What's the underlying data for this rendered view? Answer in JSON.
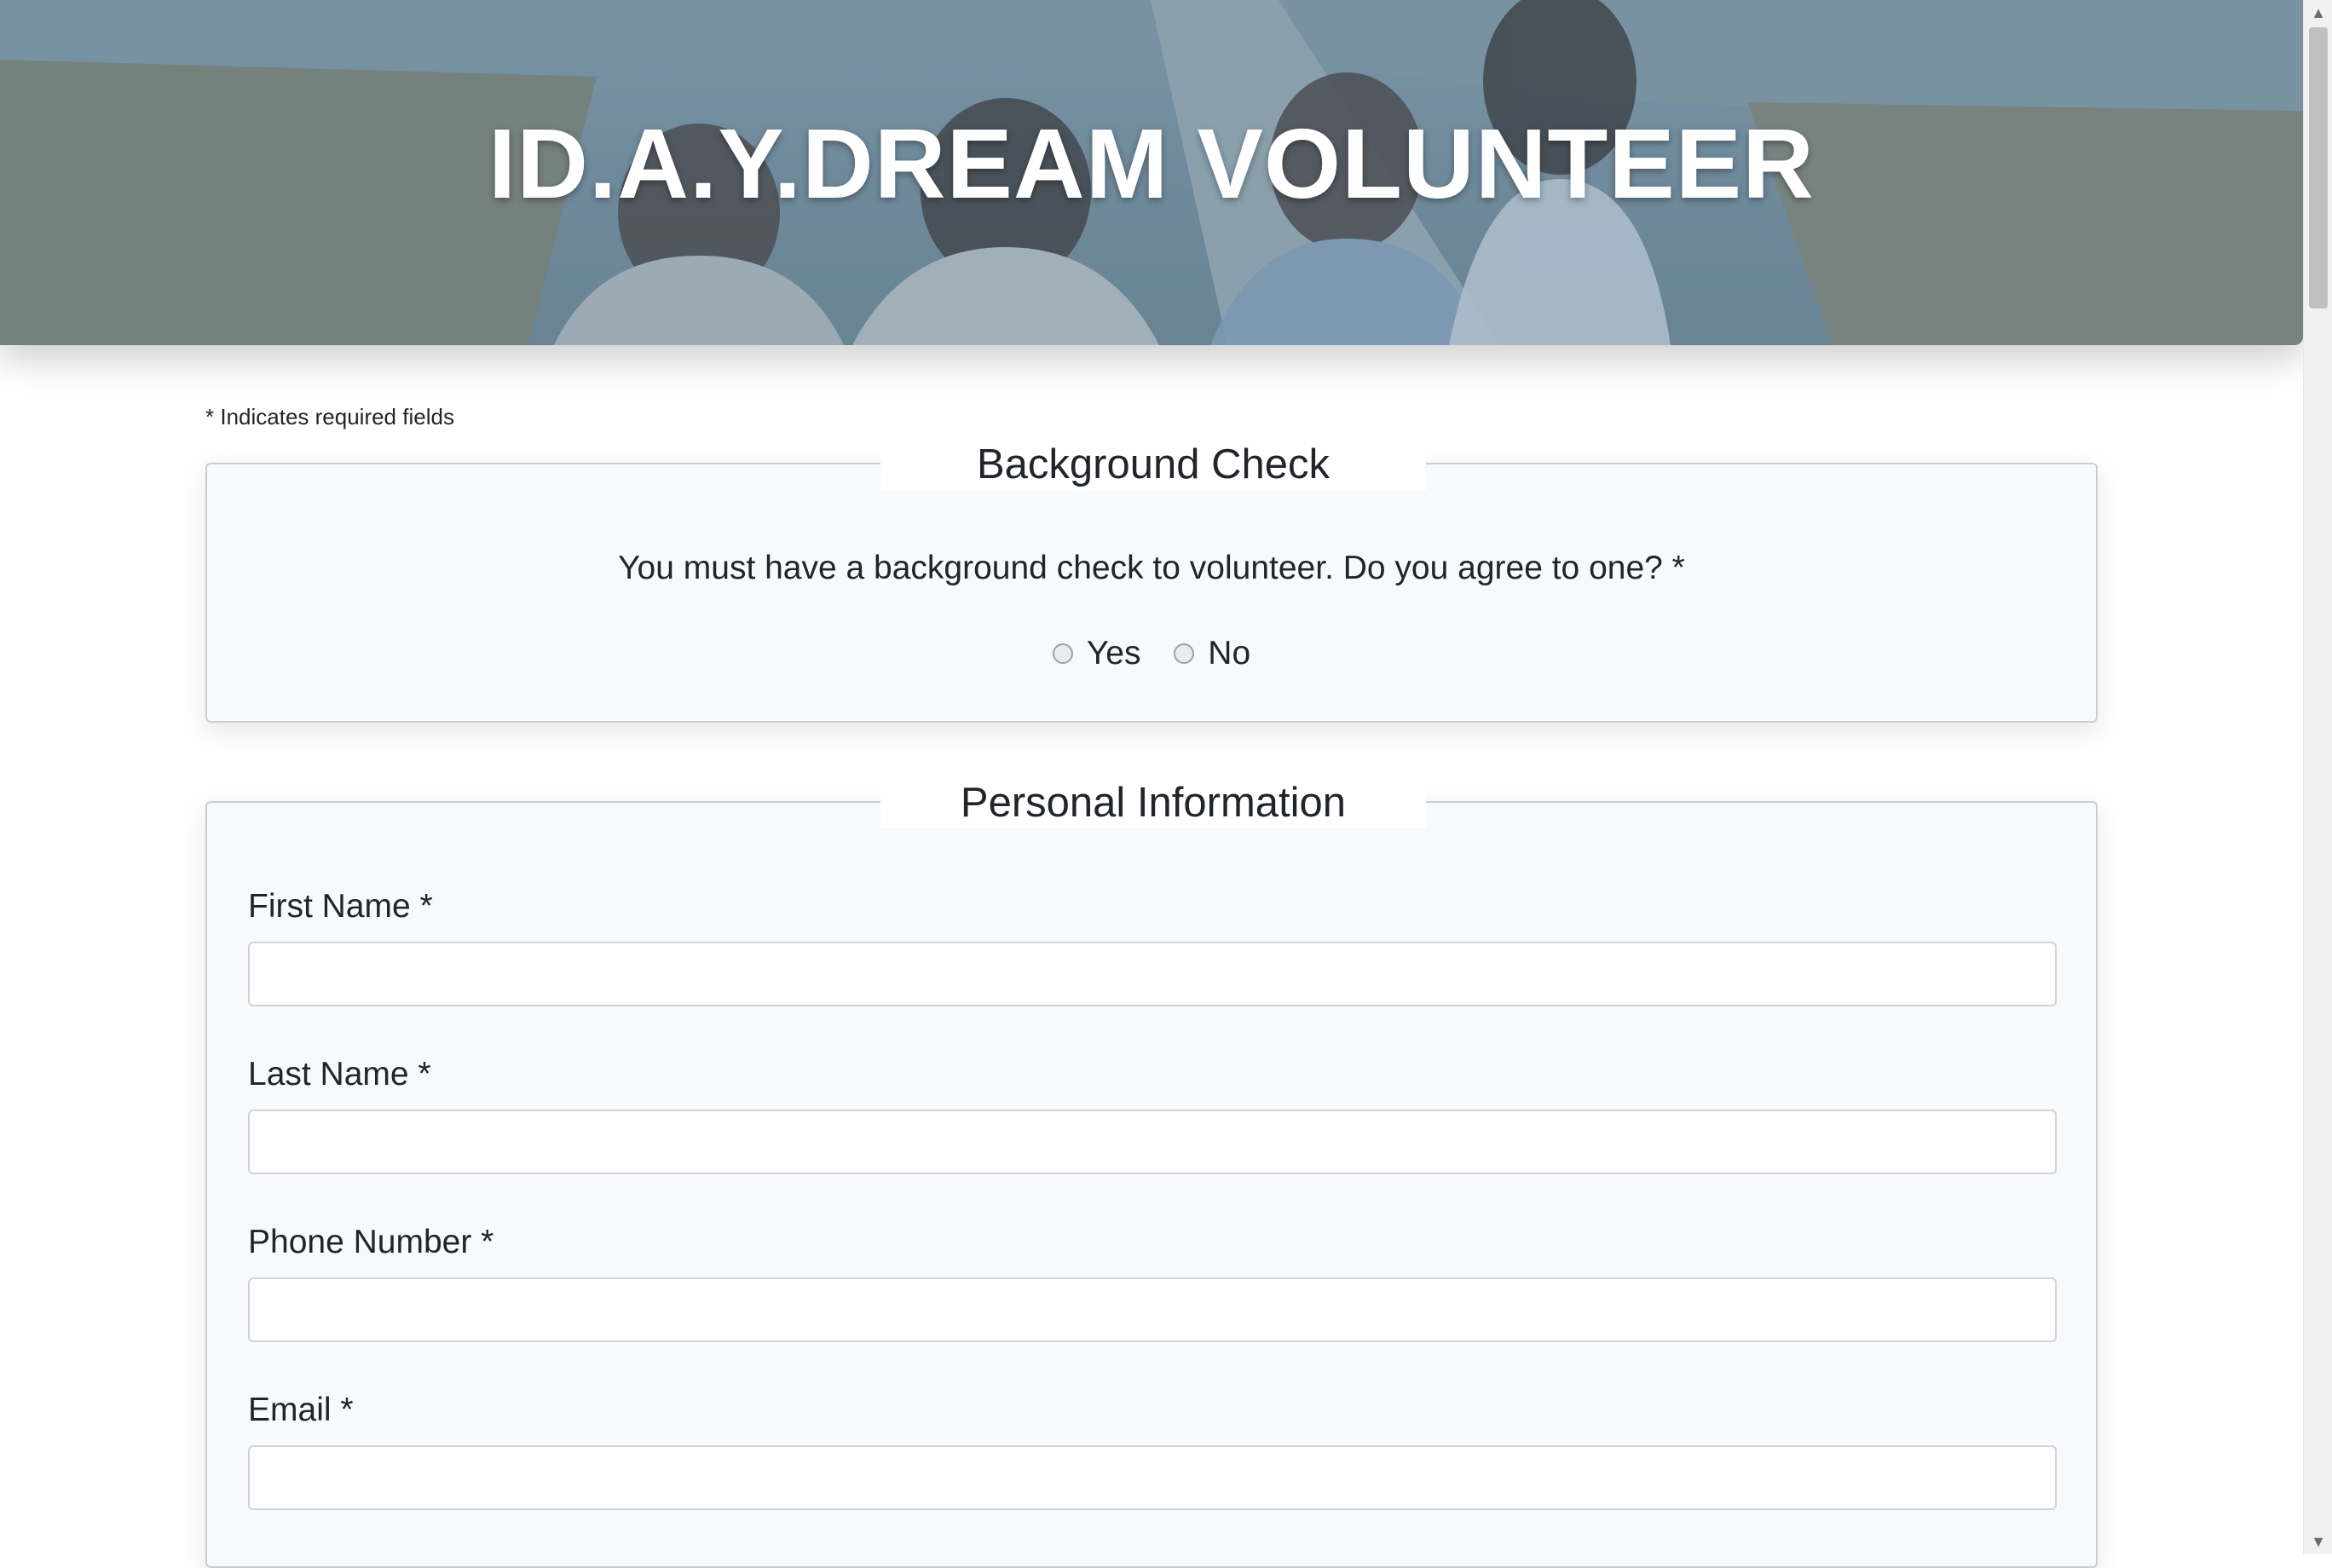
{
  "hero": {
    "title": "ID.A.Y.DREAM VOLUNTEER"
  },
  "form": {
    "required_note": "* Indicates required fields",
    "background_check": {
      "legend": "Background Check",
      "question": "You must have a background check to volunteer. Do you agree to one? *",
      "options": [
        "Yes",
        "No"
      ]
    },
    "personal_information": {
      "legend": "Personal Information",
      "fields": [
        {
          "label": "First Name *",
          "value": "",
          "placeholder": ""
        },
        {
          "label": "Last Name *",
          "value": "",
          "placeholder": ""
        },
        {
          "label": "Phone Number *",
          "value": "",
          "placeholder": ""
        },
        {
          "label": "Email *",
          "value": "",
          "placeholder": ""
        }
      ]
    }
  },
  "colors": {
    "hero_tint": "#56829e",
    "section_bg": "#f8f9fa",
    "border": "#ced4da",
    "text": "#212529"
  },
  "icons": {
    "scroll_up": "triangle-up-icon",
    "scroll_down": "triangle-down-icon"
  }
}
